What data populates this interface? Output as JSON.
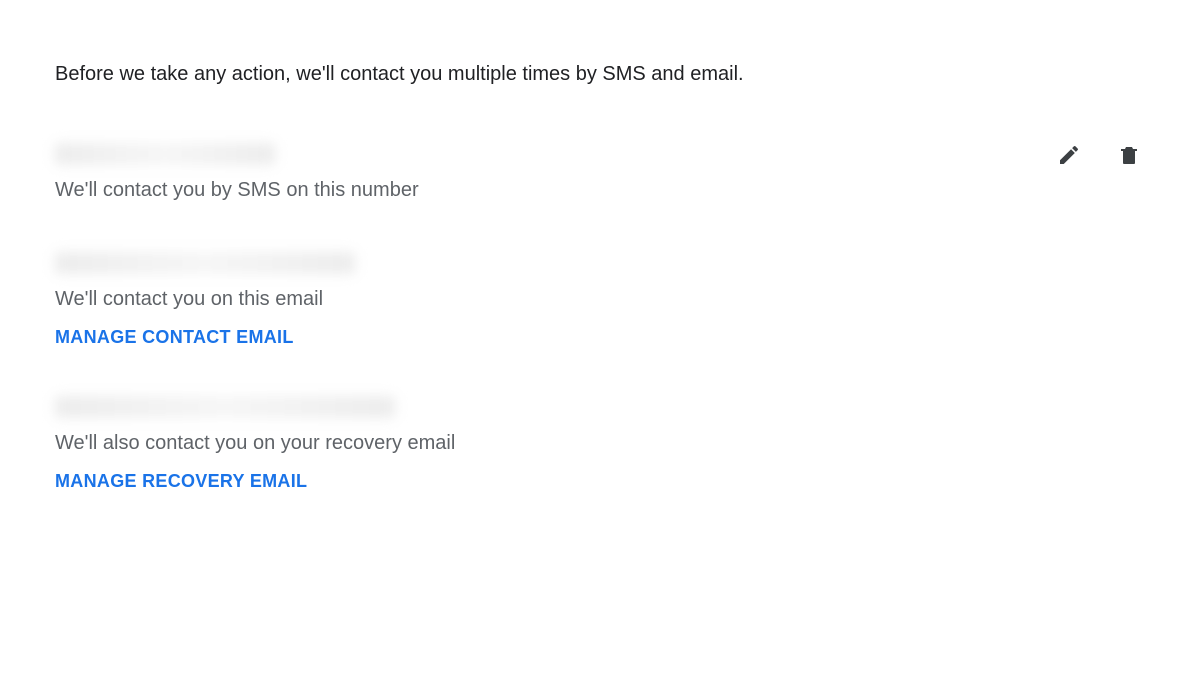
{
  "intro_text": "Before we take any action, we'll contact you multiple times by SMS and email.",
  "phone_section": {
    "value_redacted": true,
    "description": "We'll contact you by SMS on this number"
  },
  "contact_email_section": {
    "value_redacted": true,
    "description": "We'll contact you on this email",
    "link_label": "MANAGE CONTACT EMAIL"
  },
  "recovery_email_section": {
    "value_redacted": true,
    "description": "We'll also contact you on your recovery email",
    "link_label": "MANAGE RECOVERY EMAIL"
  },
  "icons": {
    "edit": "pencil-icon",
    "delete": "trash-icon"
  },
  "colors": {
    "text_primary": "#202124",
    "text_secondary": "#5f6368",
    "link": "#1a73e8",
    "icon": "#3c4043"
  }
}
